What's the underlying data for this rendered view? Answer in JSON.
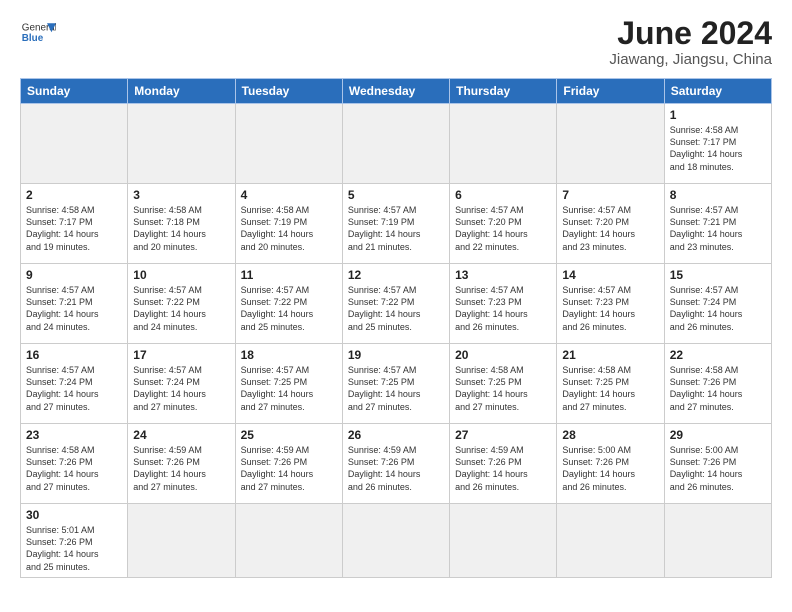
{
  "header": {
    "title": "June 2024",
    "location": "Jiawang, Jiangsu, China",
    "logo_general": "General",
    "logo_blue": "Blue"
  },
  "weekdays": [
    "Sunday",
    "Monday",
    "Tuesday",
    "Wednesday",
    "Thursday",
    "Friday",
    "Saturday"
  ],
  "days": [
    {
      "num": "",
      "info": ""
    },
    {
      "num": "",
      "info": ""
    },
    {
      "num": "",
      "info": ""
    },
    {
      "num": "",
      "info": ""
    },
    {
      "num": "",
      "info": ""
    },
    {
      "num": "",
      "info": ""
    },
    {
      "num": "1",
      "info": "Sunrise: 4:58 AM\nSunset: 7:17 PM\nDaylight: 14 hours\nand 18 minutes."
    },
    {
      "num": "2",
      "info": "Sunrise: 4:58 AM\nSunset: 7:17 PM\nDaylight: 14 hours\nand 19 minutes."
    },
    {
      "num": "3",
      "info": "Sunrise: 4:58 AM\nSunset: 7:18 PM\nDaylight: 14 hours\nand 20 minutes."
    },
    {
      "num": "4",
      "info": "Sunrise: 4:58 AM\nSunset: 7:19 PM\nDaylight: 14 hours\nand 20 minutes."
    },
    {
      "num": "5",
      "info": "Sunrise: 4:57 AM\nSunset: 7:19 PM\nDaylight: 14 hours\nand 21 minutes."
    },
    {
      "num": "6",
      "info": "Sunrise: 4:57 AM\nSunset: 7:20 PM\nDaylight: 14 hours\nand 22 minutes."
    },
    {
      "num": "7",
      "info": "Sunrise: 4:57 AM\nSunset: 7:20 PM\nDaylight: 14 hours\nand 23 minutes."
    },
    {
      "num": "8",
      "info": "Sunrise: 4:57 AM\nSunset: 7:21 PM\nDaylight: 14 hours\nand 23 minutes."
    },
    {
      "num": "9",
      "info": "Sunrise: 4:57 AM\nSunset: 7:21 PM\nDaylight: 14 hours\nand 24 minutes."
    },
    {
      "num": "10",
      "info": "Sunrise: 4:57 AM\nSunset: 7:22 PM\nDaylight: 14 hours\nand 24 minutes."
    },
    {
      "num": "11",
      "info": "Sunrise: 4:57 AM\nSunset: 7:22 PM\nDaylight: 14 hours\nand 25 minutes."
    },
    {
      "num": "12",
      "info": "Sunrise: 4:57 AM\nSunset: 7:22 PM\nDaylight: 14 hours\nand 25 minutes."
    },
    {
      "num": "13",
      "info": "Sunrise: 4:57 AM\nSunset: 7:23 PM\nDaylight: 14 hours\nand 26 minutes."
    },
    {
      "num": "14",
      "info": "Sunrise: 4:57 AM\nSunset: 7:23 PM\nDaylight: 14 hours\nand 26 minutes."
    },
    {
      "num": "15",
      "info": "Sunrise: 4:57 AM\nSunset: 7:24 PM\nDaylight: 14 hours\nand 26 minutes."
    },
    {
      "num": "16",
      "info": "Sunrise: 4:57 AM\nSunset: 7:24 PM\nDaylight: 14 hours\nand 27 minutes."
    },
    {
      "num": "17",
      "info": "Sunrise: 4:57 AM\nSunset: 7:24 PM\nDaylight: 14 hours\nand 27 minutes."
    },
    {
      "num": "18",
      "info": "Sunrise: 4:57 AM\nSunset: 7:25 PM\nDaylight: 14 hours\nand 27 minutes."
    },
    {
      "num": "19",
      "info": "Sunrise: 4:57 AM\nSunset: 7:25 PM\nDaylight: 14 hours\nand 27 minutes."
    },
    {
      "num": "20",
      "info": "Sunrise: 4:58 AM\nSunset: 7:25 PM\nDaylight: 14 hours\nand 27 minutes."
    },
    {
      "num": "21",
      "info": "Sunrise: 4:58 AM\nSunset: 7:25 PM\nDaylight: 14 hours\nand 27 minutes."
    },
    {
      "num": "22",
      "info": "Sunrise: 4:58 AM\nSunset: 7:26 PM\nDaylight: 14 hours\nand 27 minutes."
    },
    {
      "num": "23",
      "info": "Sunrise: 4:58 AM\nSunset: 7:26 PM\nDaylight: 14 hours\nand 27 minutes."
    },
    {
      "num": "24",
      "info": "Sunrise: 4:59 AM\nSunset: 7:26 PM\nDaylight: 14 hours\nand 27 minutes."
    },
    {
      "num": "25",
      "info": "Sunrise: 4:59 AM\nSunset: 7:26 PM\nDaylight: 14 hours\nand 27 minutes."
    },
    {
      "num": "26",
      "info": "Sunrise: 4:59 AM\nSunset: 7:26 PM\nDaylight: 14 hours\nand 26 minutes."
    },
    {
      "num": "27",
      "info": "Sunrise: 4:59 AM\nSunset: 7:26 PM\nDaylight: 14 hours\nand 26 minutes."
    },
    {
      "num": "28",
      "info": "Sunrise: 5:00 AM\nSunset: 7:26 PM\nDaylight: 14 hours\nand 26 minutes."
    },
    {
      "num": "29",
      "info": "Sunrise: 5:00 AM\nSunset: 7:26 PM\nDaylight: 14 hours\nand 26 minutes."
    },
    {
      "num": "30",
      "info": "Sunrise: 5:01 AM\nSunset: 7:26 PM\nDaylight: 14 hours\nand 25 minutes."
    }
  ]
}
